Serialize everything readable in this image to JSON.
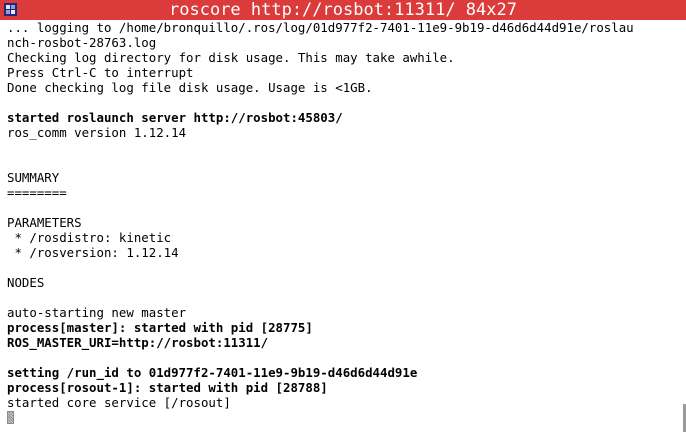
{
  "window": {
    "title": "roscore http://rosbot:11311/ 84x27",
    "titlebar_color": "#dc3b3b"
  },
  "terminal": {
    "lines": [
      {
        "text": "... logging to /home/bronquillo/.ros/log/01d977f2-7401-11e9-9b19-d46d6d44d91e/roslau",
        "bold": false
      },
      {
        "text": "nch-rosbot-28763.log",
        "bold": false
      },
      {
        "text": "Checking log directory for disk usage. This may take awhile.",
        "bold": false
      },
      {
        "text": "Press Ctrl-C to interrupt",
        "bold": false
      },
      {
        "text": "Done checking log file disk usage. Usage is <1GB.",
        "bold": false
      },
      {
        "text": "",
        "bold": false
      },
      {
        "text": "started roslaunch server http://rosbot:45803/",
        "bold": true
      },
      {
        "text": "ros_comm version 1.12.14",
        "bold": false
      },
      {
        "text": "",
        "bold": false
      },
      {
        "text": "",
        "bold": false
      },
      {
        "text": "SUMMARY",
        "bold": false
      },
      {
        "text": "========",
        "bold": false
      },
      {
        "text": "",
        "bold": false
      },
      {
        "text": "PARAMETERS",
        "bold": false
      },
      {
        "text": " * /rosdistro: kinetic",
        "bold": false
      },
      {
        "text": " * /rosversion: 1.12.14",
        "bold": false
      },
      {
        "text": "",
        "bold": false
      },
      {
        "text": "NODES",
        "bold": false
      },
      {
        "text": "",
        "bold": false
      },
      {
        "text": "auto-starting new master",
        "bold": false
      },
      {
        "text": "process[master]: started with pid [28775]",
        "bold": true
      },
      {
        "text": "ROS_MASTER_URI=http://rosbot:11311/",
        "bold": true
      },
      {
        "text": "",
        "bold": false
      },
      {
        "text": "setting /run_id to 01d977f2-7401-11e9-9b19-d46d6d44d91e",
        "bold": true
      },
      {
        "text": "process[rosout-1]: started with pid [28788]",
        "bold": true
      },
      {
        "text": "started core service [/rosout]",
        "bold": false
      }
    ]
  }
}
